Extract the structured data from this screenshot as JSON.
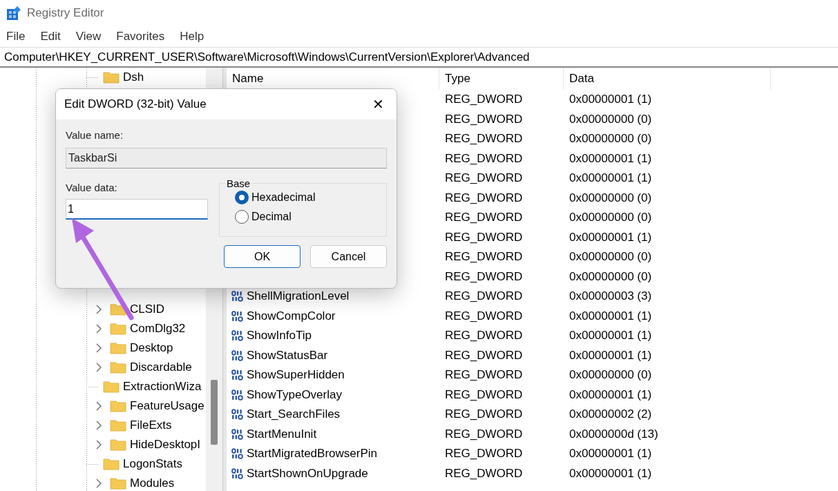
{
  "window": {
    "title": "Registry Editor"
  },
  "menu": [
    {
      "label": "File"
    },
    {
      "label": "Edit"
    },
    {
      "label": "View"
    },
    {
      "label": "Favorites"
    },
    {
      "label": "Help"
    }
  ],
  "address": "Computer\\HKEY_CURRENT_USER\\Software\\Microsoft\\Windows\\CurrentVersion\\Explorer\\Advanced",
  "tree": {
    "top_items": [
      {
        "label": "Dsh",
        "expandable": false
      }
    ],
    "items": [
      {
        "label": "CLSID",
        "expandable": true
      },
      {
        "label": "ComDlg32",
        "expandable": true
      },
      {
        "label": "Desktop",
        "expandable": true
      },
      {
        "label": "Discardable",
        "expandable": true
      },
      {
        "label": "ExtractionWiza",
        "expandable": false
      },
      {
        "label": "FeatureUsage",
        "expandable": true
      },
      {
        "label": "FileExts",
        "expandable": true
      },
      {
        "label": "HideDesktopI",
        "expandable": true
      },
      {
        "label": "LogonStats",
        "expandable": false
      },
      {
        "label": "Modules",
        "expandable": true
      }
    ]
  },
  "table": {
    "columns": [
      "Name",
      "Type",
      "Data"
    ],
    "rows": [
      {
        "type": "REG_DWORD",
        "data": "0x00000001 (1)"
      },
      {
        "type": "REG_DWORD",
        "data": "0x00000000 (0)"
      },
      {
        "type": "REG_DWORD",
        "data": "0x00000000 (0)"
      },
      {
        "type": "REG_DWORD",
        "data": "0x00000001 (1)"
      },
      {
        "type": "REG_DWORD",
        "data": "0x00000001 (1)"
      },
      {
        "type": "REG_DWORD",
        "data": "0x00000000 (0)"
      },
      {
        "type": "REG_DWORD",
        "data": "0x00000000 (0)"
      },
      {
        "type": "REG_DWORD",
        "data": "0x00000001 (1)"
      },
      {
        "type": "REG_DWORD",
        "data": "0x00000000 (0)"
      },
      {
        "type": "REG_DWORD",
        "data": "0x00000000 (0)"
      },
      {
        "name": "ShellMigrationLevel",
        "type": "REG_DWORD",
        "data": "0x00000003 (3)"
      },
      {
        "name": "ShowCompColor",
        "type": "REG_DWORD",
        "data": "0x00000001 (1)"
      },
      {
        "name": "ShowInfoTip",
        "type": "REG_DWORD",
        "data": "0x00000001 (1)"
      },
      {
        "name": "ShowStatusBar",
        "type": "REG_DWORD",
        "data": "0x00000001 (1)"
      },
      {
        "name": "ShowSuperHidden",
        "type": "REG_DWORD",
        "data": "0x00000000 (0)"
      },
      {
        "name": "ShowTypeOverlay",
        "type": "REG_DWORD",
        "data": "0x00000001 (1)"
      },
      {
        "name": "Start_SearchFiles",
        "type": "REG_DWORD",
        "data": "0x00000002 (2)"
      },
      {
        "name": "StartMenuInit",
        "type": "REG_DWORD",
        "data": "0x0000000d (13)"
      },
      {
        "name": "StartMigratedBrowserPin",
        "type": "REG_DWORD",
        "data": "0x00000001 (1)"
      },
      {
        "name": "StartShownOnUpgrade",
        "type": "REG_DWORD",
        "data": "0x00000001 (1)"
      }
    ]
  },
  "dialog": {
    "title": "Edit DWORD (32-bit) Value",
    "close": "✕",
    "value_name_label": "Value name:",
    "value_name": "TaskbarSi",
    "value_data_label": "Value data:",
    "value_data": "1",
    "base_label": "Base",
    "radios": [
      {
        "label": "Hexadecimal",
        "selected": true
      },
      {
        "label": "Decimal",
        "selected": false
      }
    ],
    "buttons": [
      {
        "label": "OK",
        "default": true
      },
      {
        "label": "Cancel",
        "default": false
      }
    ]
  }
}
